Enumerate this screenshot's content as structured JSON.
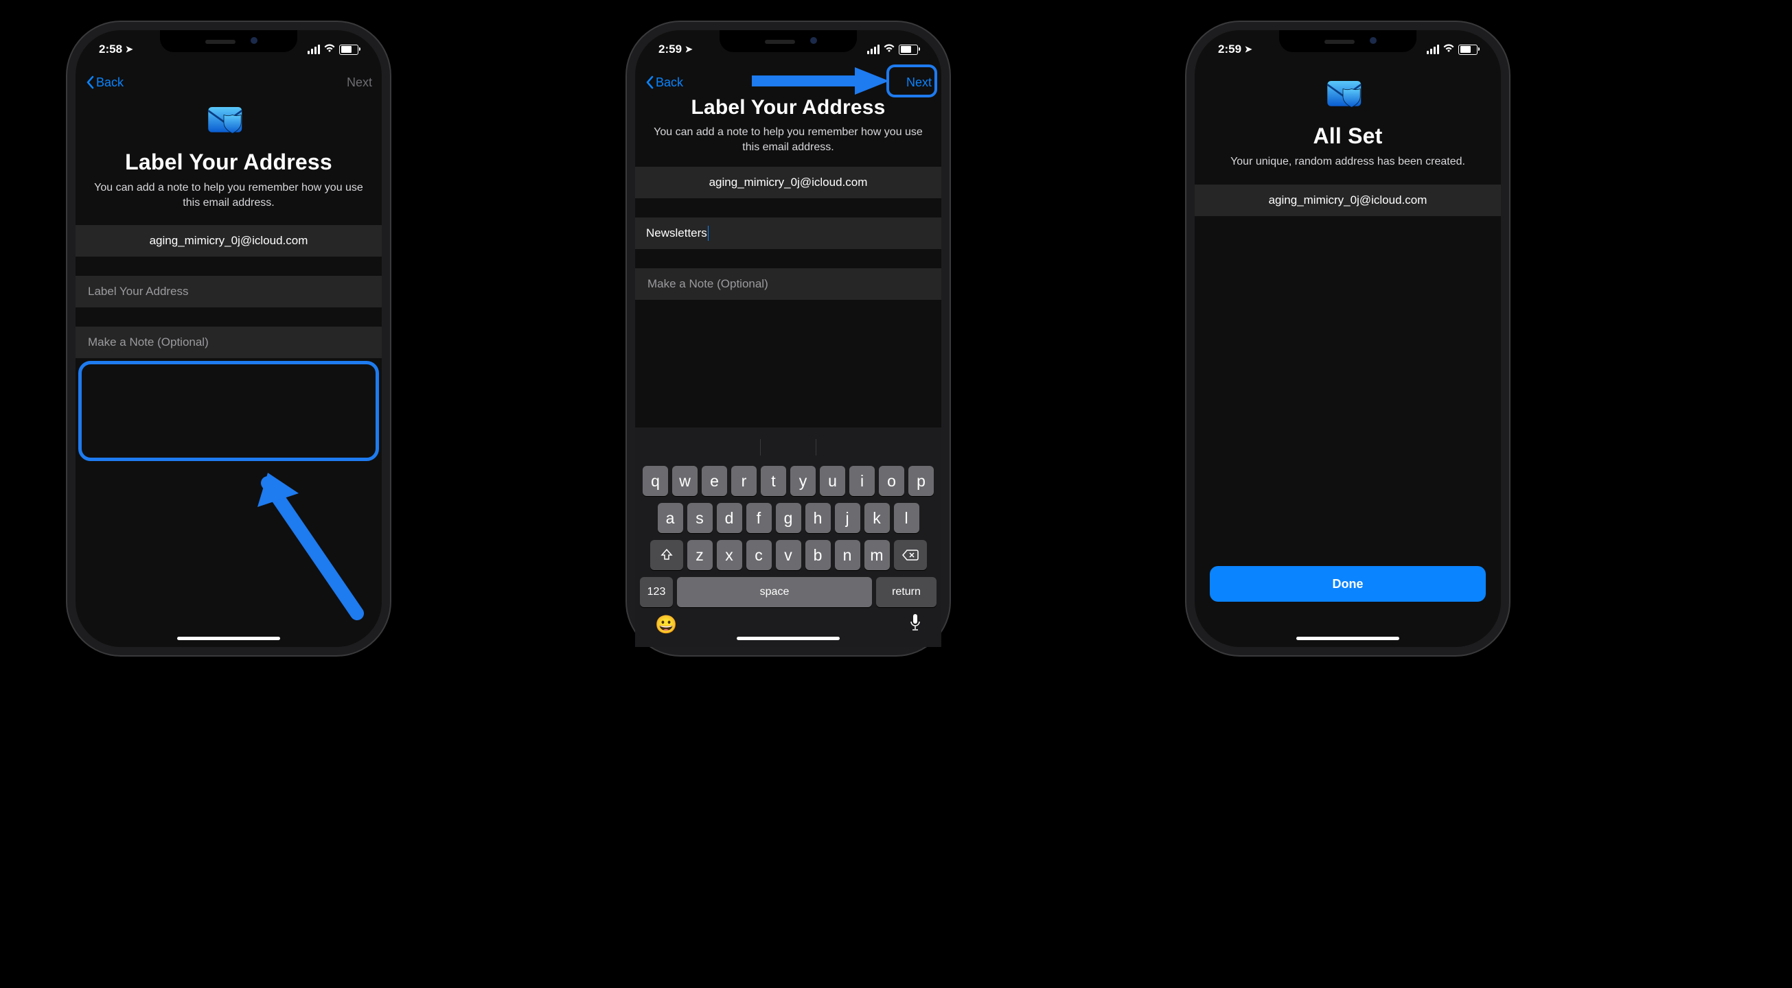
{
  "status": {
    "time1": "2:58",
    "time2": "2:59",
    "time3": "2:59"
  },
  "nav": {
    "back": "Back",
    "next": "Next"
  },
  "screen1": {
    "title": "Label Your Address",
    "subtitle": "You can add a note to help you remember how you use this email address.",
    "email": "aging_mimicry_0j@icloud.com",
    "label_placeholder": "Label Your Address",
    "note_placeholder": "Make a Note (Optional)"
  },
  "screen2": {
    "title": "Label Your Address",
    "subtitle": "You can add a note to help you remember how you use this email address.",
    "email": "aging_mimicry_0j@icloud.com",
    "label_value": "Newsletters",
    "note_placeholder": "Make a Note (Optional)"
  },
  "screen3": {
    "title": "All Set",
    "subtitle": "Your unique, random address has been created.",
    "email": "aging_mimicry_0j@icloud.com",
    "done": "Done"
  },
  "keyboard": {
    "row1": [
      "q",
      "w",
      "e",
      "r",
      "t",
      "y",
      "u",
      "i",
      "o",
      "p"
    ],
    "row2": [
      "a",
      "s",
      "d",
      "f",
      "g",
      "h",
      "j",
      "k",
      "l"
    ],
    "row3": [
      "z",
      "x",
      "c",
      "v",
      "b",
      "n",
      "m"
    ],
    "nums": "123",
    "space": "space",
    "return": "return"
  }
}
